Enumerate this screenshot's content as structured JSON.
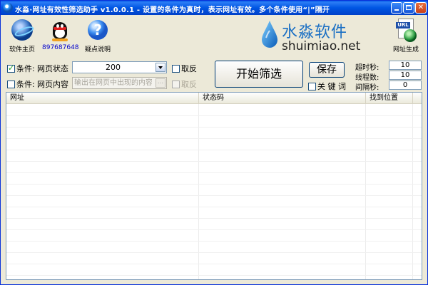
{
  "window": {
    "title": "水淼·网址有效性筛选助手 v1.0.0.1 - 设置的条件为真时，表示网址有效。多个条件使用“|”隔开"
  },
  "toolbar": {
    "home_label": "软件主页",
    "qq_label": "897687648",
    "help_label": "疑点说明",
    "url_gen_label": "网址生成",
    "url_tag": "URL"
  },
  "logo": {
    "brand_cn": "水淼软件",
    "brand_url": "shuimiao.net"
  },
  "conditions": {
    "row1": {
      "prefix": "条件:",
      "name": "网页状态",
      "value": "200",
      "invert_label": "取反",
      "checked": true
    },
    "row2": {
      "prefix": "条件:",
      "name": "网页内容",
      "placeholder": "输出在网页中出现的内容",
      "invert_label": "取反",
      "checked": false,
      "mini_btn": "..."
    }
  },
  "actions": {
    "start_label": "开始筛选",
    "save_label": "保存",
    "keyword_label": "关 键 词"
  },
  "settings": {
    "timeout_label": "超时秒:",
    "timeout_value": "10",
    "threads_label": "线程数:",
    "threads_value": "10",
    "interval_label": "间隔秒:",
    "interval_value": "0"
  },
  "table": {
    "columns": [
      "网址",
      "状态码",
      "找到位置"
    ]
  },
  "colors": {
    "titlebar": "#0056e3",
    "window_bg": "#ece9d8",
    "brand_blue": "#1a6fc4"
  }
}
